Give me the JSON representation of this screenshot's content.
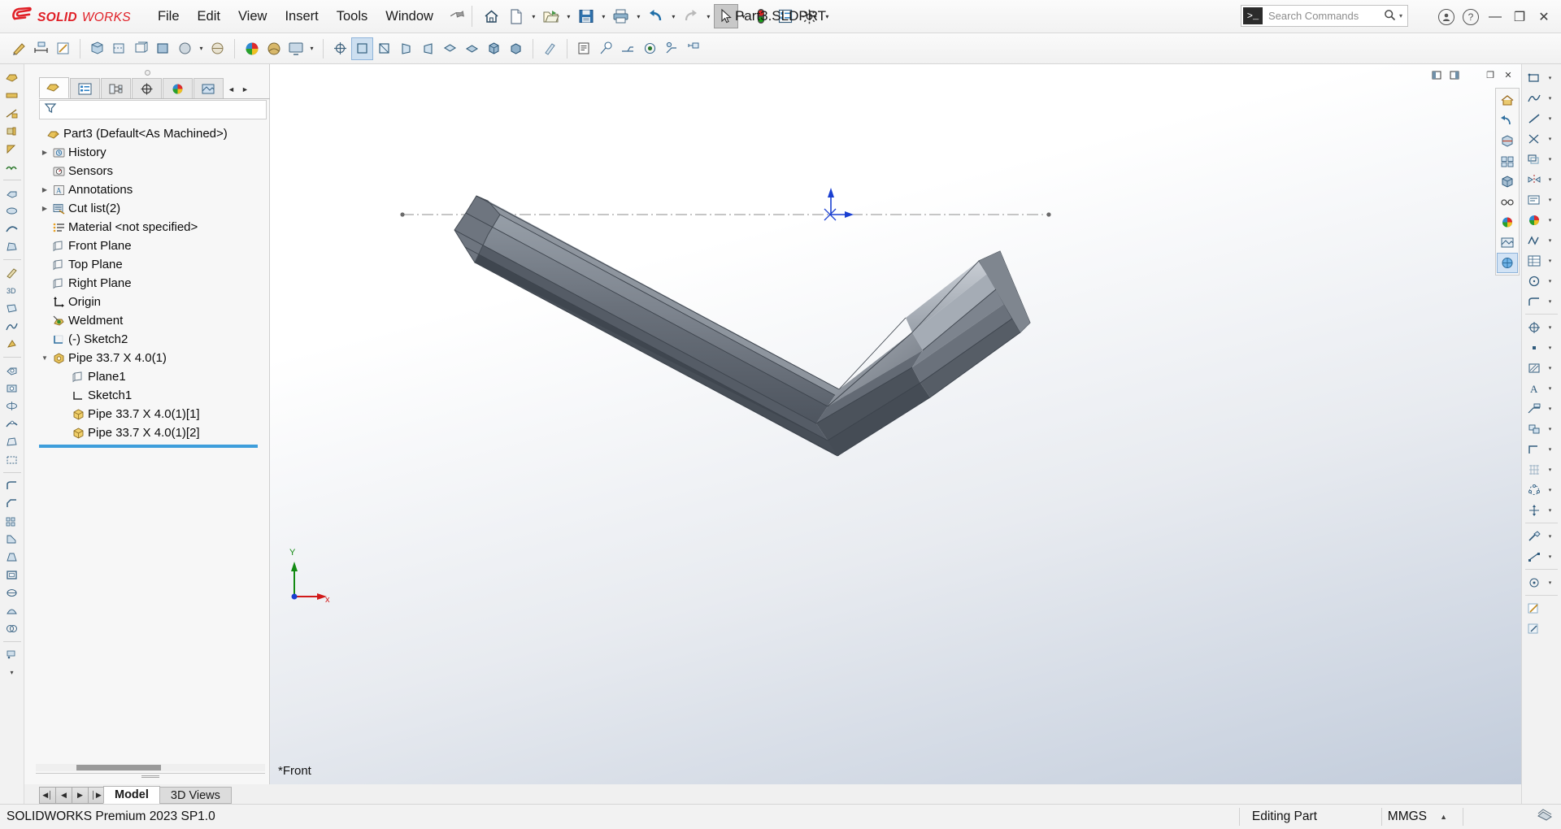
{
  "app": {
    "brand_ds": "2S",
    "brand_solid": "SOLID",
    "brand_works": "WORKS",
    "document_title": "Part3.SLDPRT",
    "version_status": "SOLIDWORKS Premium 2023 SP1.0",
    "accent_red": "#e01f26",
    "accent_blue": "#3e9edb",
    "tree_text_color": "#8a4b0a"
  },
  "menu": {
    "items": [
      {
        "label": "File"
      },
      {
        "label": "Edit"
      },
      {
        "label": "View"
      },
      {
        "label": "Insert"
      },
      {
        "label": "Tools"
      },
      {
        "label": "Window"
      }
    ],
    "pin_icon": "pushpin-icon"
  },
  "quick_access": {
    "buttons": [
      {
        "name": "home-button",
        "icon": "home-icon",
        "has_arrow": false
      },
      {
        "name": "new-document-button",
        "icon": "new-file-icon",
        "has_arrow": true
      },
      {
        "name": "open-document-button",
        "icon": "open-folder-icon",
        "has_arrow": true
      },
      {
        "name": "save-button",
        "icon": "floppy-disk-icon",
        "has_arrow": true
      },
      {
        "name": "print-button",
        "icon": "printer-icon",
        "has_arrow": true
      },
      {
        "name": "undo-button",
        "icon": "undo-arrow-icon",
        "has_arrow": true
      },
      {
        "name": "redo-button",
        "icon": "redo-arrow-icon",
        "has_arrow": true
      },
      {
        "name": "select-button",
        "icon": "cursor-arrow-icon",
        "has_arrow": true
      },
      {
        "name": "rebuild-button",
        "icon": "traffic-light-icon",
        "has_arrow": false
      },
      {
        "name": "file-properties-button",
        "icon": "properties-list-icon",
        "has_arrow": false
      },
      {
        "name": "options-button",
        "icon": "gear-icon",
        "has_arrow": true
      }
    ]
  },
  "search": {
    "placeholder": "Search Commands",
    "prompt_glyph": ">_",
    "magnifier": "search-icon"
  },
  "window_controls": {
    "account": "user-account-icon",
    "help": "help-question-icon",
    "minimize": "—",
    "restore": "❐",
    "close": "✕"
  },
  "feature_manager": {
    "tabs": [
      {
        "name": "feature-tree-tab",
        "icon": "part-tree-icon",
        "active": true
      },
      {
        "name": "property-manager-tab",
        "icon": "property-list-icon",
        "active": false
      },
      {
        "name": "configuration-manager-tab",
        "icon": "configuration-icon",
        "active": false
      },
      {
        "name": "dimxpert-manager-tab",
        "icon": "dimxpert-icon",
        "active": false
      },
      {
        "name": "display-manager-tab",
        "icon": "display-sphere-icon",
        "active": false
      },
      {
        "name": "render-manager-tab",
        "icon": "render-icon",
        "active": false
      }
    ],
    "nav_prev": "◄",
    "nav_next": "►",
    "filter_icon": "funnel-filter-icon",
    "filter_value": "",
    "tree": [
      {
        "label": "Part3 (Default<As Machined>)",
        "icon": "part-icon",
        "indent": 0,
        "twist": "none",
        "color": "dark"
      },
      {
        "label": "History",
        "icon": "history-icon",
        "indent": 1,
        "twist": "collapsed",
        "color": "dark"
      },
      {
        "label": "Sensors",
        "icon": "sensors-icon",
        "indent": 1,
        "twist": "none",
        "color": "dark"
      },
      {
        "label": "Annotations",
        "icon": "annotations-icon",
        "indent": 1,
        "twist": "collapsed",
        "color": "dark"
      },
      {
        "label": "Cut list(2)",
        "icon": "cut-list-icon",
        "indent": 1,
        "twist": "collapsed",
        "color": "dark"
      },
      {
        "label": "Material <not specified>",
        "icon": "material-icon",
        "indent": 1,
        "twist": "none",
        "color": "dark"
      },
      {
        "label": "Front Plane",
        "icon": "plane-icon",
        "indent": 1,
        "twist": "none",
        "color": "dark"
      },
      {
        "label": "Top Plane",
        "icon": "plane-icon",
        "indent": 1,
        "twist": "none",
        "color": "dark"
      },
      {
        "label": "Right Plane",
        "icon": "plane-icon",
        "indent": 1,
        "twist": "none",
        "color": "dark"
      },
      {
        "label": "Origin",
        "icon": "origin-icon",
        "indent": 1,
        "twist": "none",
        "color": "dark"
      },
      {
        "label": "Weldment",
        "icon": "weldment-icon",
        "indent": 1,
        "twist": "none",
        "color": "dark"
      },
      {
        "label": "(-) Sketch2",
        "icon": "sketch-icon",
        "indent": 1,
        "twist": "none",
        "color": "dark"
      },
      {
        "label": "Pipe 33.7 X 4.0(1)",
        "icon": "structural-member-icon",
        "indent": 1,
        "twist": "expanded",
        "color": "dark"
      },
      {
        "label": "Plane1",
        "icon": "plane-icon",
        "indent": 2,
        "twist": "none",
        "color": "dark"
      },
      {
        "label": "Sketch1",
        "icon": "sketch-icon",
        "indent": 2,
        "twist": "none",
        "color": "dark"
      },
      {
        "label": "Pipe 33.7 X 4.0(1)[1]",
        "icon": "solid-body-icon",
        "indent": 2,
        "twist": "none",
        "color": "dark"
      },
      {
        "label": "Pipe 33.7 X 4.0(1)[2]",
        "icon": "solid-body-icon",
        "indent": 2,
        "twist": "none",
        "color": "dark"
      }
    ]
  },
  "bottom_tabs": {
    "nav": [
      "◀│",
      "◀",
      "▶",
      "│▶"
    ],
    "tabs": [
      {
        "label": "Model",
        "active": true
      },
      {
        "label": "3D Views",
        "active": false
      }
    ]
  },
  "graphics": {
    "view_label": "*Front",
    "triad": {
      "x_label": "x",
      "y_label": "Y",
      "x_color": "#d11a1a",
      "y_color": "#138a13",
      "z_color": "#1a3fd1"
    },
    "window_controls": {
      "restore_child": "❐",
      "maximize_child": "□",
      "minimize_child": "—",
      "restore": "❐",
      "close": "✕"
    },
    "model": {
      "description": "Two pipe structural members forming a V shape",
      "body_color": "#6e747e",
      "origin_marker_color": "#1a3fd1"
    }
  },
  "heads_up": {
    "buttons": [
      {
        "name": "zoom-to-fit-button",
        "icon": "home-view-icon"
      },
      {
        "name": "previous-view-button",
        "icon": "previous-view-icon"
      },
      {
        "name": "section-view-button",
        "icon": "section-view-icon"
      },
      {
        "name": "view-orientation-button",
        "icon": "view-orientation-icon"
      },
      {
        "name": "display-style-button",
        "icon": "display-style-icon"
      },
      {
        "name": "hide-show-items-button",
        "icon": "eyeglasses-icon"
      },
      {
        "name": "edit-appearance-button",
        "icon": "appearance-sphere-icon"
      },
      {
        "name": "apply-scene-button",
        "icon": "scene-icon"
      },
      {
        "name": "view-settings-button",
        "icon": "view-settings-icon",
        "selected": true
      }
    ]
  },
  "status_bar": {
    "version": "SOLIDWORKS Premium 2023 SP1.0",
    "editing": "Editing Part",
    "units": "MMGS",
    "units_caret": "▲",
    "overlay_icon": "overlay-icon"
  },
  "command_toolbar": {
    "groups": [
      [
        "sketch-icon",
        "smart-dimension-icon",
        "edit-sketch-icon"
      ],
      [
        "section-view-icon",
        "view-orientation-icon",
        "display-style-icon",
        "appearance-sphere-icon"
      ],
      [
        "measure-icon",
        "mass-properties-icon",
        "screen-capture-icon"
      ],
      [
        "zoom-fit-icon",
        "zoom-area-icon",
        "rotate-icon",
        "pan-icon"
      ],
      [
        "front-view-icon",
        "back-view-icon",
        "left-view-icon",
        "right-view-icon",
        "top-view-icon",
        "bottom-view-icon",
        "iso-view-icon",
        "trimetric-icon"
      ],
      [
        "shaded-icon"
      ],
      [
        "notes-icon",
        "balloon-icon",
        "weld-symbol-icon",
        "surface-finish-icon",
        "hole-callout-icon",
        "datum-icon"
      ]
    ]
  },
  "left_rail": {
    "icons": [
      "weldment-feature-icon",
      "structural-member-icon",
      "trim-extend-icon",
      "end-cap-icon",
      "gusset-icon",
      "weld-bead-icon",
      "fillet-bead-icon",
      "extruded-boss-icon",
      "revolved-boss-icon",
      "swept-boss-icon",
      "sketch-icon",
      "3d-sketch-icon",
      "reference-geometry-icon",
      "curves-icon",
      "instant3d-icon",
      "extruded-cut-icon",
      "hole-wizard-icon",
      "revolved-cut-icon",
      "swept-cut-icon",
      "lofted-cut-icon",
      "boundary-cut-icon",
      "fillet-icon",
      "chamfer-icon",
      "linear-pattern-icon",
      "rib-icon",
      "draft-icon",
      "shell-icon",
      "wrap-icon",
      "dome-icon",
      "intersect-icon"
    ]
  }
}
